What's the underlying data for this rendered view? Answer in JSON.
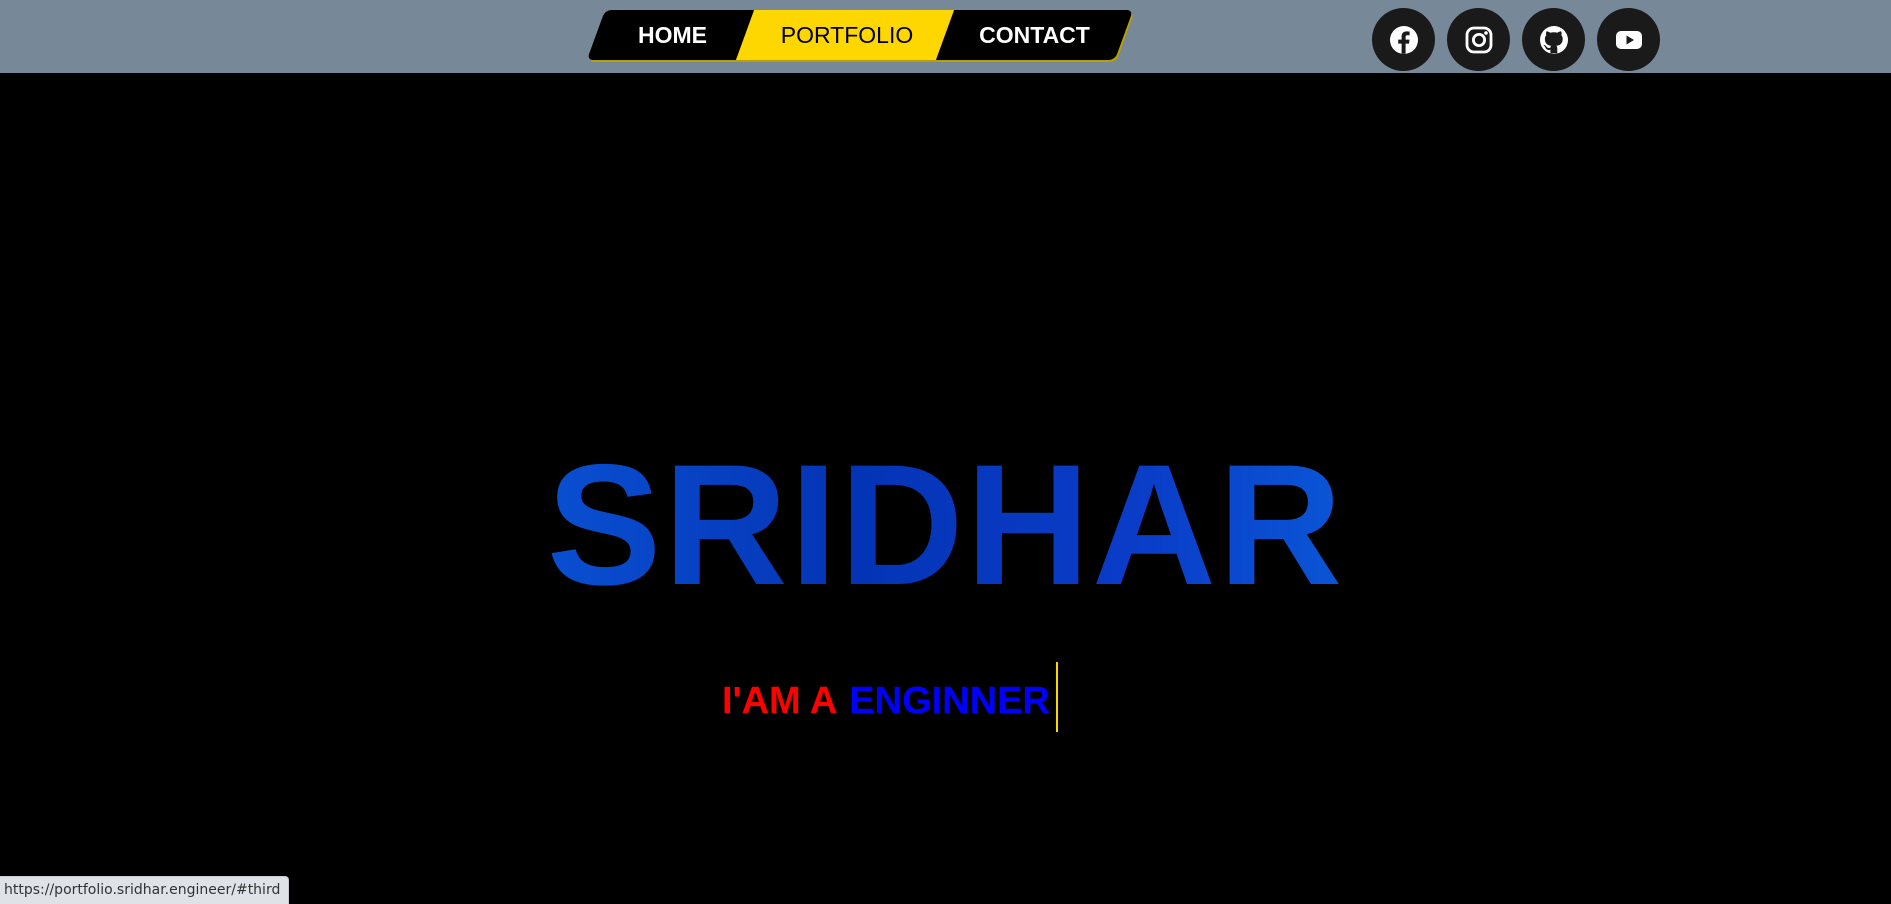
{
  "nav": {
    "items": [
      {
        "label": "HOME"
      },
      {
        "label": "PORTFOLIO",
        "active": true
      },
      {
        "label": "CONTACT"
      }
    ],
    "active_color": "#ffd700"
  },
  "social": [
    {
      "icon": "facebook-icon"
    },
    {
      "icon": "instagram-icon"
    },
    {
      "icon": "github-icon"
    },
    {
      "icon": "youtube-icon"
    }
  ],
  "hero": {
    "name": "SRIDHAR",
    "tagline_prefix": "I'AM A",
    "tagline_role": "ENGINNER"
  },
  "status_bar": {
    "url": "https://portfolio.sridhar.engineer/#third"
  },
  "colors": {
    "header_bg": "#778899",
    "page_bg": "#000000",
    "tagline_prefix": "#ff0000",
    "tagline_role": "#0000ff",
    "cursor": "#ffd700"
  }
}
